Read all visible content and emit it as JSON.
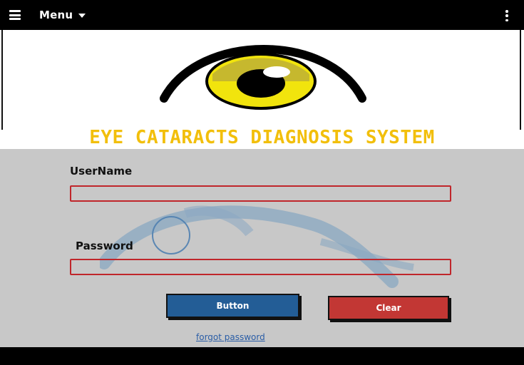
{
  "header": {
    "menu_label": "Menu"
  },
  "app": {
    "title": "EYE CATARACTS DIAGNOSIS SYSTEM"
  },
  "login": {
    "username_label": "UserName",
    "username_value": "",
    "password_label": "Password",
    "password_value": "",
    "submit_label": "Button",
    "clear_label": "Clear",
    "forgot_label": "forgot password"
  },
  "icons": {
    "hamburger": "hamburger-menu-icon",
    "menu_caret": "caret-down-icon",
    "kebab": "kebab-menu-icon",
    "logo": "eye-logo-icon",
    "watermark": "eye-watermark-icon"
  },
  "colors": {
    "topbar": "#000000",
    "title": "#f2bf0b",
    "panel": "#c8c8c8",
    "field_border": "#c0262b",
    "primary_button": "#235d96",
    "clear_button": "#c23734",
    "link": "#2a5da6"
  }
}
